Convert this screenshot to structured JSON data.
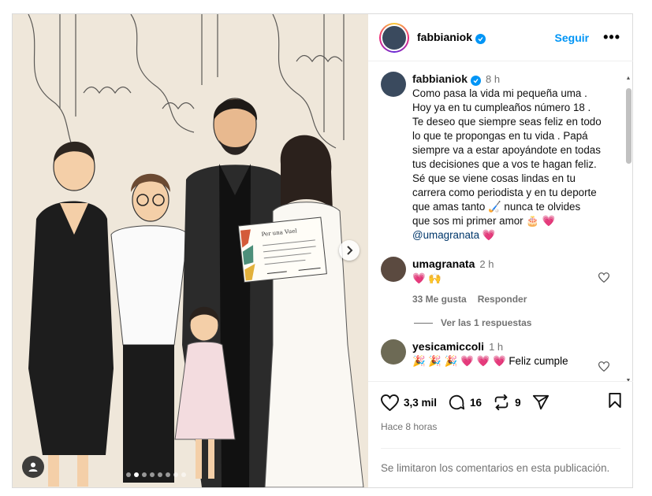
{
  "header": {
    "username": "fabbianiok",
    "follow_label": "Seguir",
    "more_label": "•••"
  },
  "caption": {
    "username": "fabbianiok",
    "time": "8 h",
    "lines": [
      "Como pasa la vida mi pequeña uma .",
      "Hoy ya en tu cumpleaños número 18 .",
      "Te deseo que siempre seas feliz en todo",
      "lo que te propongas en tu vida . Papá",
      "siempre va a estar apoyándote en todas",
      "tus decisiones que a vos te hagan feliz.",
      "Sé que se viene cosas lindas en tu",
      "carrera como periodista y en tu deporte",
      "que amas tanto 🏑 nunca te olvides",
      "que sos mi primer amor 🎂 💗"
    ],
    "mention": "@umagranata",
    "mention_suffix": " 💗"
  },
  "comments": [
    {
      "username": "umagranata",
      "time": "2 h",
      "text": "💗 🙌",
      "likes": "33 Me gusta",
      "reply_label": "Responder",
      "view_replies": "Ver las 1 respuestas"
    },
    {
      "username": "yesicamiccoli",
      "time": "1 h",
      "text": "🎉 🎉 🎉 💗 💗 💗  Feliz cumple"
    }
  ],
  "actions": {
    "likes_count": "3,3 mil",
    "comments_count": "16",
    "reposts_count": "9",
    "time_ago": "Hace 8 horas"
  },
  "comments_limited": "Se limitaron los comentarios en esta publicación.",
  "media": {
    "certificate_title": "Per una Vuel",
    "carousel_total": 8,
    "carousel_active": 2
  }
}
